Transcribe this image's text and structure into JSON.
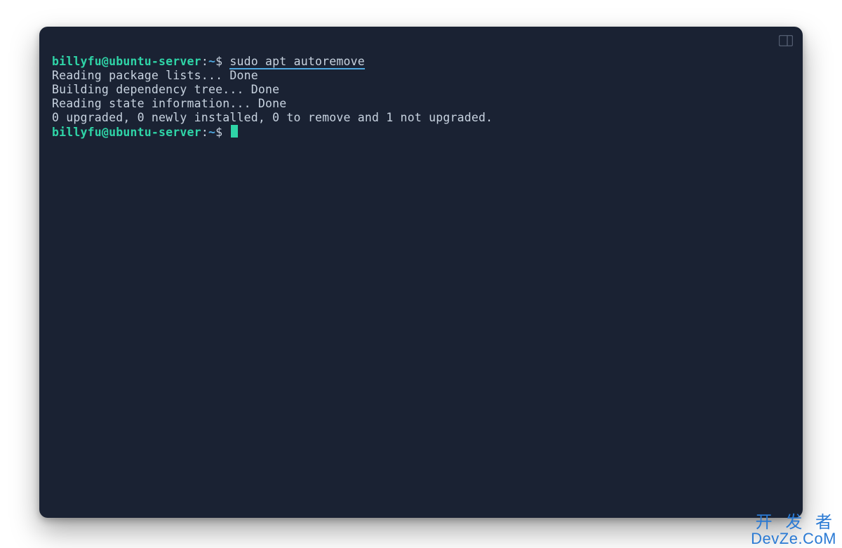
{
  "prompt": {
    "user_host": "billyfu@ubuntu-server",
    "separator": ":",
    "path": "~",
    "symbol": "$"
  },
  "command": "sudo apt autoremove",
  "output": {
    "line1_a": "Reading package lists... ",
    "line1_b": "Done",
    "line2_a": "Building dependency tree... ",
    "line2_b": "Done",
    "line3_a": "Reading state information... ",
    "line3_b": "Done",
    "line4": "0 upgraded, 0 newly installed, 0 to remove and 1 not upgraded."
  },
  "watermark": {
    "line1": "开 发 者",
    "line2": "DevZe.CoM"
  },
  "colors": {
    "bg": "#1a2233",
    "prompt_green": "#2fd4a7",
    "prompt_blue": "#4fa8e0",
    "text": "#c8d3e0"
  }
}
